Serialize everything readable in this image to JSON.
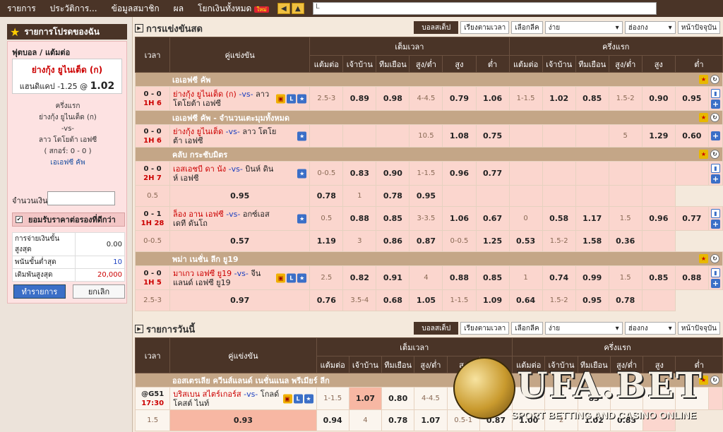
{
  "topnav": {
    "items": [
      "รายการ",
      "ประวัติการ...",
      "ข้อมูลสมาชิก",
      "ผล",
      "โยกเงินทั้งหมด"
    ],
    "new_badge": "ใหม่",
    "search_value": "L"
  },
  "sidebar": {
    "favorites_title": "รายการโปรดของฉัน",
    "slip_title": "ฟุตบอล / แต้มต่อ",
    "pick_team": "ย่างกุ้ง ยูไนเต็ด (ก)",
    "pick_hdp_label": "แฮนดิแคป",
    "pick_hdp_value": "-1.25",
    "pick_at": "@",
    "pick_odds": "1.02",
    "period": "ครึ่งแรก",
    "home": "ย่างกุ้ง ยูไนเต็ด (ก)",
    "vs": "-vs-",
    "away": "ลาว โตโยต้า เอฟซี",
    "score": "( สกอร์: 0 - 0 )",
    "league": "เอเอฟซี คัพ",
    "amount_label": "จำนวนเงิน:",
    "accept_label": "ยอมรับราคาต่อรองที่ดีกว่า",
    "limits": [
      {
        "label": "การจ่ายเงินขั้นสูงสุด",
        "value": "0.00",
        "color": "#222"
      },
      {
        "label": "พนันขั้นต่ำสุด",
        "value": "10",
        "color": "#1a3fc0"
      },
      {
        "label": "เดิมพันสูงสุด",
        "value": "20,000",
        "color": "#c00"
      }
    ],
    "submit_label": "ทำรายการ",
    "cancel_label": "ยกเลิก"
  },
  "live": {
    "title": "การแข่งขันสด",
    "controls": {
      "view": "บอลสเต็ป",
      "sort": "เรียงตามเวลา",
      "pick_league": "เลือกลีค",
      "mode": "ง่าย",
      "odds_type": "ฮ่องกง",
      "page": "หน้าปัจจุบัน"
    },
    "headers": {
      "time": "เวลา",
      "match": "คู่แข่งขัน",
      "fulltime": "เต็มเวลา",
      "firsthalf": "ครึ่งแรก",
      "hdp": "แต้มต่อ",
      "home": "เจ้าบ้าน",
      "away": "ทีมเยือน",
      "ou": "สูง/ต่ำ",
      "over": "สูง",
      "under": "ต่ำ"
    }
  },
  "today": {
    "title": "รายการวันนี้",
    "controls": {
      "view": "บอลสเต็ป",
      "sort": "เรียงตามเวลา",
      "pick_league": "เลือกลีค",
      "mode": "ง่าย",
      "odds_type": "ฮ่องกง",
      "page": "หน้าปัจจุบัน"
    },
    "headers": {
      "time": "เวลา",
      "match": "คู่แข่งขัน",
      "fulltime": "เต็มเวลา",
      "firsthalf": "ครึ่งแรก",
      "hdp": "แต้มต่อ",
      "home": "เจ้าบ้าน",
      "away": "ทีมเยือน",
      "ou": "สูง/ต่ำ",
      "over": "สูง",
      "under": "ต่ำ"
    }
  },
  "leagues": [
    "เอเอฟซี คัพ",
    "เอเอฟซี คัพ - จำนวนเตะมุมทั้งหมด",
    "คลับ กระชับมิตร",
    "พม่า เนชั่น ลีก ยู19",
    "ออสเตรเลีย ควีนส์แลนด์ เนชั่นแนล พรีเมียร์ ลีก"
  ],
  "matches": [
    {
      "score": "0 - 0",
      "period": "1H 6",
      "home": "ย่างกุ้ง ยูไนเต็ด (ก)",
      "vs": "-vs-",
      "away": "ลาว โตโยต้า เอฟซี",
      "ft": [
        "2.5-3",
        "0.89",
        "0.98",
        "4-4.5",
        "0.79",
        "1.06"
      ],
      "fh": [
        "1-1.5",
        "1.02",
        "0.85",
        "1.5-2",
        "0.90",
        "0.95"
      ]
    },
    {
      "score": "0 - 0",
      "period": "1H 6",
      "home": "ย่างกุ้ง ยูไนเต็ด",
      "vs": "-vs-",
      "away": "ลาว โตโยต้า เอฟซี",
      "ft": [
        "",
        "",
        "",
        "10.5",
        "1.08",
        "0.75"
      ],
      "fh": [
        "",
        "",
        "",
        "5",
        "1.29",
        "0.60"
      ]
    },
    {
      "score": "0 - 0",
      "period": "2H 7",
      "home": "เอสเอชบี ดา นัง",
      "vs": "-vs-",
      "away": "บินห์ ดินห์ เอฟซี",
      "ft": [
        "0-0.5",
        "0.83",
        "0.90",
        "1-1.5",
        "0.96",
        "0.77"
      ],
      "fh": [
        "",
        "",
        "",
        "",
        "",
        ""
      ]
    },
    {
      "ft": [
        "0.5",
        "0.95",
        "0.78",
        "1",
        "0.78",
        "0.95"
      ],
      "fh": [
        "",
        "",
        "",
        "",
        "",
        ""
      ]
    },
    {
      "score": "0 - 1",
      "period": "1H 28",
      "home": "ล็อง อาน เอฟซี",
      "vs": "-vs-",
      "away": "อกซ์เอสเดที ดันโถ",
      "ft": [
        "0.5",
        "0.88",
        "0.85",
        "3-3.5",
        "1.06",
        "0.67"
      ],
      "fh": [
        "0",
        "0.58",
        "1.17",
        "1.5",
        "0.96",
        "0.77"
      ]
    },
    {
      "ft": [
        "0-0.5",
        "0.57",
        "1.19",
        "3",
        "0.86",
        "0.87"
      ],
      "fh": [
        "0-0.5",
        "1.25",
        "0.53",
        "1.5-2",
        "1.58",
        "0.36"
      ]
    },
    {
      "score": "0 - 0",
      "period": "1H 5",
      "home": "มาเกว เอฟซี ยู19",
      "vs": "-vs-",
      "away": "จีนแลนด์ เอฟซี ยู19",
      "ft": [
        "2.5",
        "0.82",
        "0.91",
        "4",
        "0.88",
        "0.85"
      ],
      "fh": [
        "1",
        "0.74",
        "0.99",
        "1.5",
        "0.85",
        "0.88"
      ]
    },
    {
      "ft": [
        "2.5-3",
        "0.97",
        "0.76",
        "3.5-4",
        "0.68",
        "1.05"
      ],
      "fh": [
        "1-1.5",
        "1.09",
        "0.64",
        "1.5-2",
        "0.95",
        "0.78"
      ]
    }
  ],
  "today_matches": [
    {
      "score": "@G51",
      "period": "17:30",
      "home": "บริสเบน สไตร์เกอร์ส",
      "vs": "-vs-",
      "away": "โกลด์ โคสต์ ไนท์",
      "ft": [
        "1-1.5",
        "1.07",
        "0.80",
        "4-4.5",
        "0.9",
        "0.8"
      ],
      "fh": [
        "",
        "",
        "83",
        "",
        "",
        ""
      ]
    },
    {
      "ft": [
        "1.5",
        "0.93",
        "0.94",
        "4",
        "0.78",
        "1.07"
      ],
      "fh": [
        "0.5-1",
        "0.87",
        "1.00",
        "2",
        "1.02",
        "0.83"
      ]
    }
  ],
  "watermark": {
    "brand": "UFA.BET",
    "tagline": "SPORT BETTING AND CASINO ONLINE"
  }
}
